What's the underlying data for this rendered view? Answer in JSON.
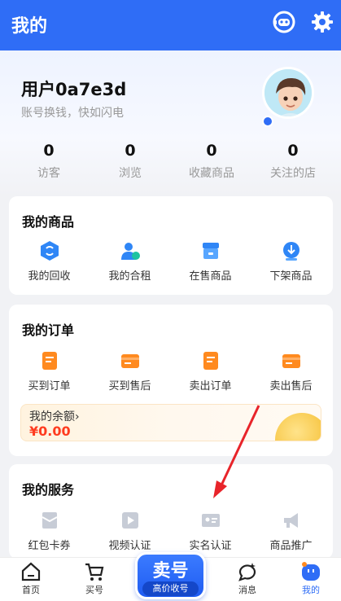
{
  "header": {
    "title": "我的",
    "icons": [
      "robot-icon",
      "gear-icon"
    ]
  },
  "profile": {
    "username": "用户0a7e3d",
    "slogan": "账号换钱，快如闪电"
  },
  "stats": [
    {
      "value": "0",
      "label": "访客"
    },
    {
      "value": "0",
      "label": "浏览"
    },
    {
      "value": "0",
      "label": "收藏商品"
    },
    {
      "value": "0",
      "label": "关注的店"
    }
  ],
  "goods": {
    "title": "我的商品",
    "items": [
      {
        "label": "我的回收",
        "icon": "recycle-icon"
      },
      {
        "label": "我的合租",
        "icon": "shared-rent-icon"
      },
      {
        "label": "在售商品",
        "icon": "store-icon"
      },
      {
        "label": "下架商品",
        "icon": "download-icon"
      }
    ]
  },
  "orders": {
    "title": "我的订单",
    "items": [
      {
        "label": "买到订单",
        "icon": "order-icon"
      },
      {
        "label": "买到售后",
        "icon": "after-sale-icon"
      },
      {
        "label": "卖出订单",
        "icon": "order-icon"
      },
      {
        "label": "卖出售后",
        "icon": "after-sale-icon"
      }
    ],
    "balance": {
      "label": "我的余额›",
      "value": "¥0.00"
    }
  },
  "services": {
    "title": "我的服务",
    "items": [
      {
        "label": "红包卡券",
        "icon": "coupon-icon"
      },
      {
        "label": "视频认证",
        "icon": "video-icon"
      },
      {
        "label": "实名认证",
        "icon": "id-card-icon"
      },
      {
        "label": "商品推广",
        "icon": "megaphone-icon"
      }
    ]
  },
  "tabbar": {
    "tabs": [
      {
        "label": "首页",
        "icon": "home-icon"
      },
      {
        "label": "买号",
        "icon": "cart-icon"
      },
      {
        "label": "消息",
        "icon": "chat-icon"
      },
      {
        "label": "我的",
        "icon": "profile-icon"
      }
    ],
    "sell": {
      "main": "卖号",
      "sub": "高价收号"
    }
  },
  "colors": {
    "primary": "#2f6df6",
    "orange": "#ff8a1f",
    "price": "#ff3b1f"
  }
}
